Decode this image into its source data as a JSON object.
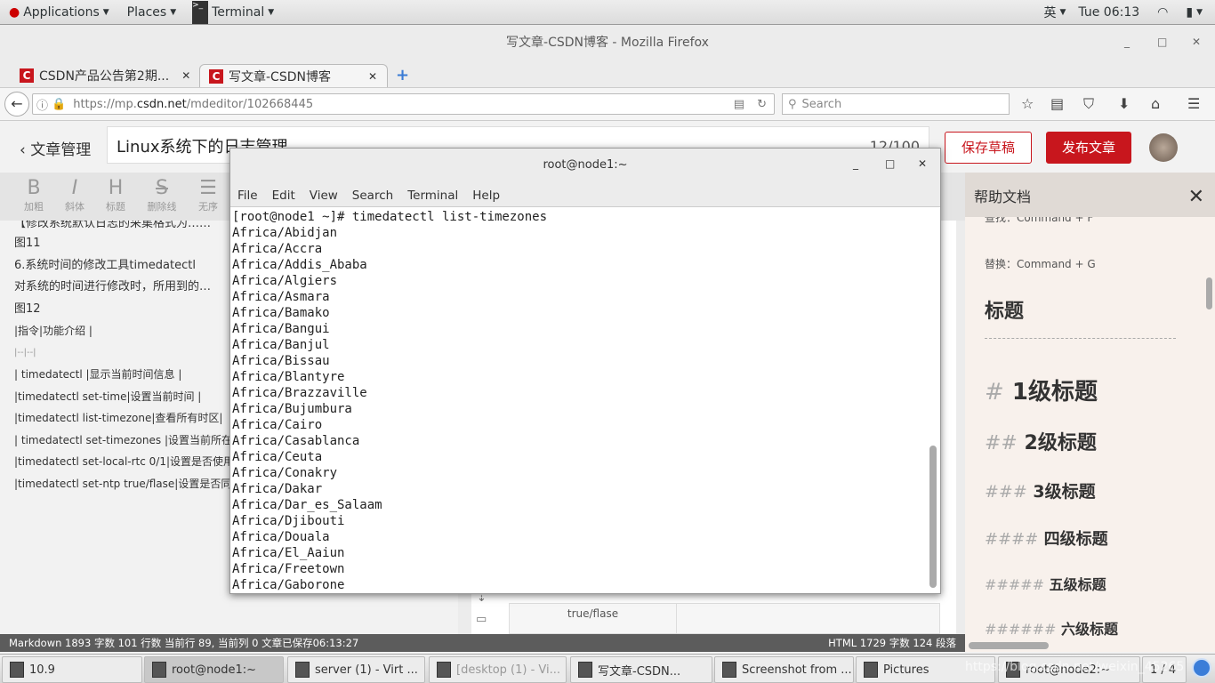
{
  "topbar": {
    "applications": "Applications",
    "places": "Places",
    "terminal": "Terminal",
    "input_method": "英",
    "clock": "Tue 06:13"
  },
  "firefox": {
    "window_title": "写文章-CSDN博客 - Mozilla Firefox",
    "tabs": [
      {
        "label": "CSDN产品公告第2期..."
      },
      {
        "label": "写文章-CSDN博客"
      }
    ],
    "url_prefix": "https://mp.",
    "url_domain": "csdn.net",
    "url_path": "/mdeditor/102668445",
    "search_placeholder": "Search"
  },
  "editor": {
    "back_label": "文章管理",
    "title": "Linux系统下的日志管理",
    "title_count": "12/100",
    "save_draft": "保存草稿",
    "publish": "发布文章",
    "toolbar": [
      {
        "glyph": "B",
        "label": "加粗"
      },
      {
        "glyph": "I",
        "label": "斜体"
      },
      {
        "glyph": "H",
        "label": "标题"
      },
      {
        "glyph": "S",
        "label": "删除线"
      },
      {
        "glyph": "☰",
        "label": "无序"
      }
    ],
    "lines": [
      "【修改系统默认日志的采集格式为……",
      "图11",
      "6.系统时间的修改工具timedatectl",
      "对系统的时间进行修改时，所用到的…",
      "图12",
      "|指令|功能介绍 |",
      "|--|--|",
      "| timedatectl |显示当前时间信息 |",
      "|timedatectl set-time|设置当前时间 |",
      "|timedatectl list-timezone|查看所有时区|",
      "| timedatectl set-timezones |设置当前所在…",
      "|timedatectl set-local-rtc 0/1|设置是否使用…",
      "|timedatectl set-ntp true/flase|设置是否同步…"
    ],
    "preview_cell": "true/flase"
  },
  "status": {
    "left": "Markdown  1893 字数  101 行数  当前行 89, 当前列 0  文章已保存06:13:27",
    "right": "HTML  1729 字数  124 段落"
  },
  "help": {
    "title": "帮助文档",
    "find": "查找：Command + F",
    "replace": "替换：Command + G",
    "section": "标题",
    "headings": [
      {
        "hash": "#",
        "text": "1级标题"
      },
      {
        "hash": "##",
        "text": "2级标题"
      },
      {
        "hash": "###",
        "text": "3级标题"
      },
      {
        "hash": "####",
        "text": "四级标题"
      },
      {
        "hash": "#####",
        "text": "五级标题"
      },
      {
        "hash": "######",
        "text": "六级标题"
      }
    ]
  },
  "terminal": {
    "title": "root@node1:~",
    "menu": [
      "File",
      "Edit",
      "View",
      "Search",
      "Terminal",
      "Help"
    ],
    "lines": [
      "[root@node1 ~]# timedatectl list-timezones",
      "Africa/Abidjan",
      "Africa/Accra",
      "Africa/Addis_Ababa",
      "Africa/Algiers",
      "Africa/Asmara",
      "Africa/Bamako",
      "Africa/Bangui",
      "Africa/Banjul",
      "Africa/Bissau",
      "Africa/Blantyre",
      "Africa/Brazzaville",
      "Africa/Bujumbura",
      "Africa/Cairo",
      "Africa/Casablanca",
      "Africa/Ceuta",
      "Africa/Conakry",
      "Africa/Dakar",
      "Africa/Dar_es_Salaam",
      "Africa/Djibouti",
      "Africa/Douala",
      "Africa/El_Aaiun",
      "Africa/Freetown",
      "Africa/Gaborone"
    ]
  },
  "taskbar": [
    {
      "label": "10.9"
    },
    {
      "label": "root@node1:~",
      "active": true
    },
    {
      "label": "server (1) - Virt ..."
    },
    {
      "label": "[desktop (1) - Vi..."
    },
    {
      "label": "写文章-CSDN..."
    },
    {
      "label": "Screenshot from ..."
    },
    {
      "label": "Pictures"
    },
    {
      "label": "root@node2:~"
    }
  ],
  "workspace": "1 / 4",
  "watermark": "https://blog.csdn.net/weixin_45265"
}
